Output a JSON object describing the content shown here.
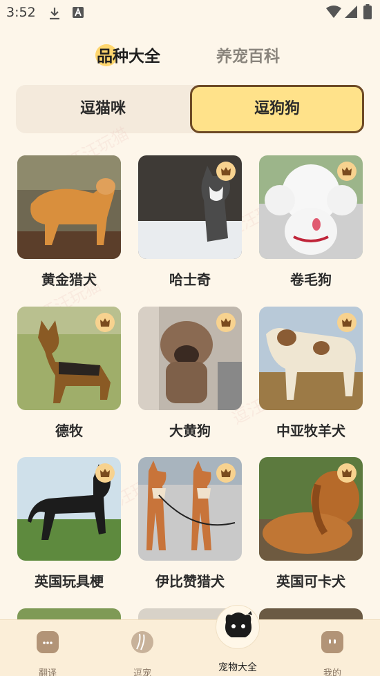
{
  "status_bar": {
    "time": "3:52"
  },
  "top_tabs": [
    {
      "label": "品种大全",
      "active": true
    },
    {
      "label": "养宠百科",
      "active": false
    }
  ],
  "segment": {
    "left_label": "逗猫咪",
    "right_label": "逗狗狗",
    "selected": "逗狗狗"
  },
  "breeds": [
    {
      "name": "黄金猎犬",
      "vip": false
    },
    {
      "name": "哈士奇",
      "vip": true
    },
    {
      "name": "卷毛狗",
      "vip": true
    },
    {
      "name": "德牧",
      "vip": true
    },
    {
      "name": "大黄狗",
      "vip": true
    },
    {
      "name": "中亚牧羊犬",
      "vip": true
    },
    {
      "name": "英国玩具梗",
      "vip": true
    },
    {
      "name": "伊比赞猎犬",
      "vip": true
    },
    {
      "name": "英国可卡犬",
      "vip": true
    }
  ],
  "bottom_nav": [
    {
      "label": "翻译",
      "icon": "chat-icon"
    },
    {
      "label": "逗宠",
      "icon": "paw-ball-icon"
    },
    {
      "label": "宠物大全",
      "icon": "pet-face-icon",
      "active": true
    },
    {
      "label": "我的",
      "icon": "profile-icon"
    }
  ],
  "colors": {
    "accent": "#ffe28a",
    "accent_border": "#6e4a25",
    "background": "#fdf6ea",
    "crown": "#f7d28f"
  }
}
